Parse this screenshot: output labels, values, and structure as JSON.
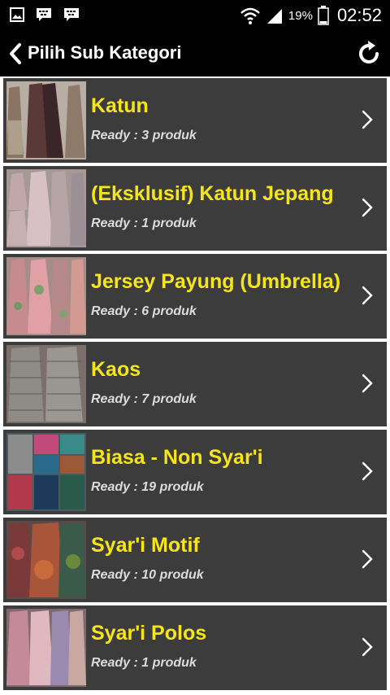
{
  "status_bar": {
    "battery_percent": "19%",
    "time": "02:52",
    "icons": [
      "gallery-icon",
      "bbm-icon",
      "bbm-icon",
      "wifi-icon",
      "signal-icon",
      "battery-icon"
    ]
  },
  "header": {
    "title": "Pilih Sub Kategori",
    "back_icon": "chevron-left-icon",
    "refresh_icon": "refresh-icon"
  },
  "items": [
    {
      "title": "Katun",
      "count": "Ready : 3 produk"
    },
    {
      "title": "(Eksklusif) Katun Jepang",
      "count": "Ready : 1 produk"
    },
    {
      "title": "Jersey Payung (Umbrella)",
      "count": "Ready : 6 produk"
    },
    {
      "title": "Kaos",
      "count": "Ready : 7 produk"
    },
    {
      "title": "Biasa - Non Syar'i",
      "count": "Ready : 19 produk"
    },
    {
      "title": "Syar'i Motif",
      "count": "Ready : 10 produk"
    },
    {
      "title": "Syar'i Polos",
      "count": "Ready : 1 produk"
    }
  ],
  "colors": {
    "title_yellow": "#f5e51a",
    "row_background": "#3c3c3c",
    "bar_background": "#000000"
  }
}
